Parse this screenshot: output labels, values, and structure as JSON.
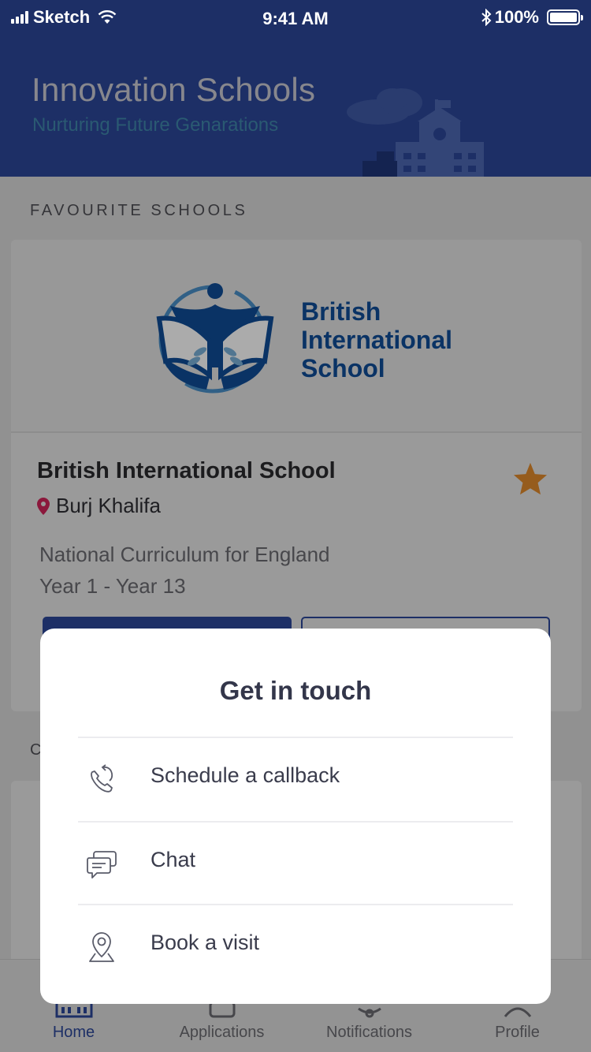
{
  "status_bar": {
    "carrier": "Sketch",
    "time": "9:41 AM",
    "battery": "100%"
  },
  "header": {
    "title": "Innovation Schools",
    "subtitle": "Nurturing Future Genarations"
  },
  "favourites": {
    "section_label": "FAVOURITE SCHOOLS",
    "school": {
      "logo_text": [
        "British",
        "International",
        "School"
      ],
      "name": "British International School",
      "location": "Burj Khalifa",
      "curriculum": "National Curriculum for England",
      "years": "Year 1 - Year 13"
    }
  },
  "next_section": {
    "label_fragment": "C"
  },
  "modal": {
    "title": "Get in touch",
    "options": [
      {
        "label": "Schedule a callback",
        "icon": "phone-callback-icon"
      },
      {
        "label": "Chat",
        "icon": "chat-icon"
      },
      {
        "label": "Book a visit",
        "icon": "location-pin-icon"
      }
    ]
  },
  "tab_bar": {
    "tabs": [
      {
        "label": "Home",
        "icon": "home-icon",
        "active": true
      },
      {
        "label": "Applications",
        "icon": "applications-icon",
        "active": false
      },
      {
        "label": "Notifications",
        "icon": "bell-icon",
        "active": false
      },
      {
        "label": "Profile",
        "icon": "profile-icon",
        "active": false
      }
    ]
  },
  "colors": {
    "brand": "#2c4698",
    "subtitle": "#3f86aa",
    "favourite_star": "#e08a2c",
    "location_pin": "#d0245a",
    "logo_blue": "#0f4c97"
  }
}
